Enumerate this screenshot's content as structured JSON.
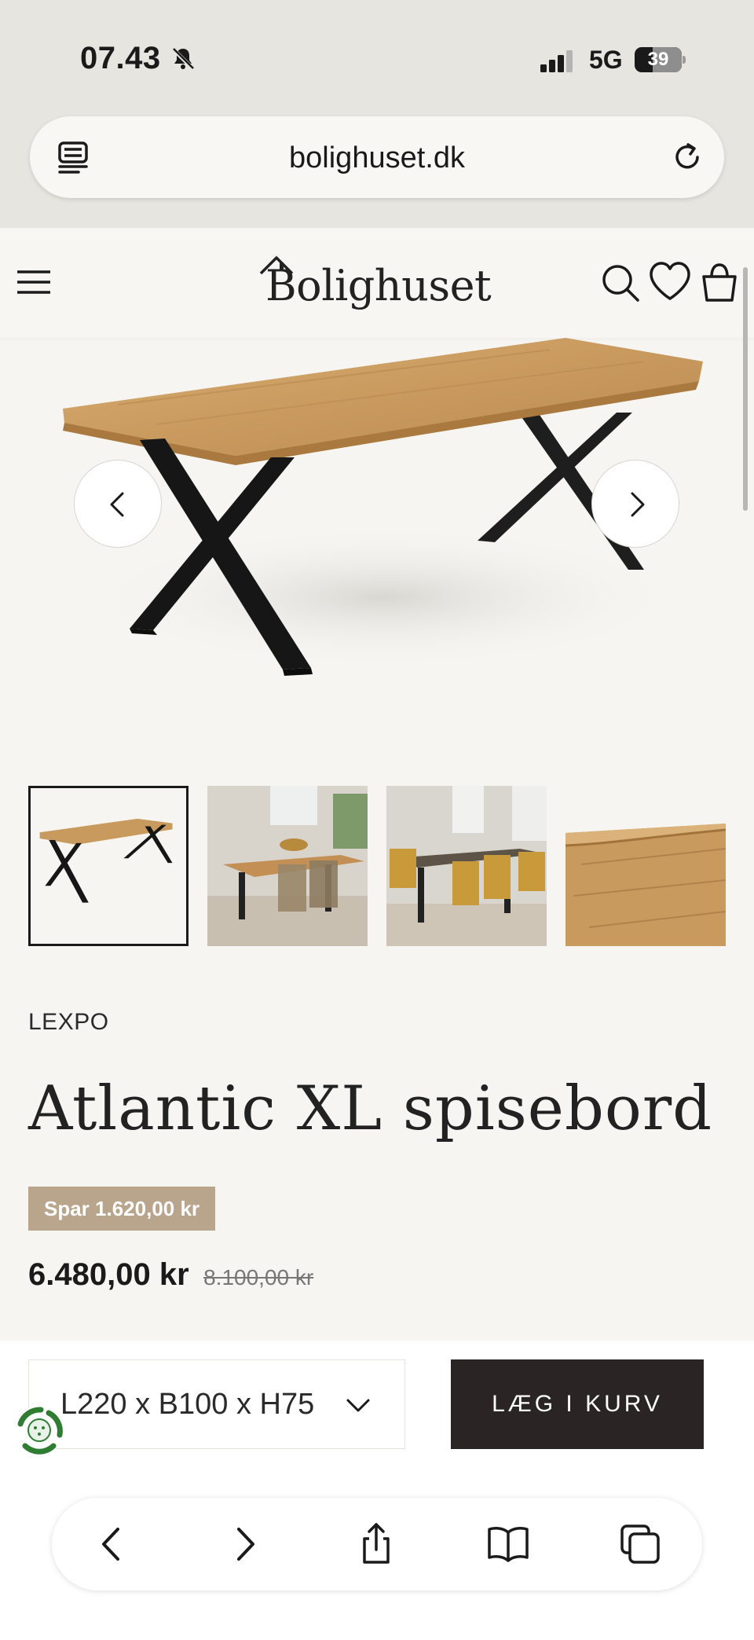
{
  "status_bar": {
    "time": "07.43",
    "network": "5G",
    "battery": "39",
    "battery_fraction": 0.39
  },
  "browser": {
    "url": "bolighuset.dk"
  },
  "header": {
    "logo": "Bolighuset"
  },
  "product": {
    "brand": "LEXPO",
    "title": "Atlantic XL spisebord",
    "save_label": "Spar 1.620,00 kr",
    "price": "6.480,00 kr",
    "old_price": "8.100,00 kr",
    "variant": "L220 x B100 x H75",
    "cart_label": "LÆG I KURV"
  },
  "gallery": {
    "thumbnails": [
      "table-on-white",
      "dining-room-scene-1",
      "dining-room-scene-2",
      "tabletop-edge-detail"
    ],
    "active_index": 0
  },
  "colors": {
    "accent_badge": "#b9a48c",
    "button_dark": "#2b2424",
    "page_bg": "#f6f5f1",
    "wood": "#c99a5e"
  },
  "icons": [
    "bell-slash-icon",
    "signal-icon",
    "battery-icon",
    "reader-icon",
    "reload-icon",
    "menu-icon",
    "search-icon",
    "heart-icon",
    "bag-icon",
    "chevron-left-icon",
    "chevron-right-icon",
    "chevron-down-icon",
    "eco-badge-icon",
    "back-icon",
    "forward-icon",
    "share-icon",
    "bookmarks-icon",
    "tabs-icon"
  ]
}
